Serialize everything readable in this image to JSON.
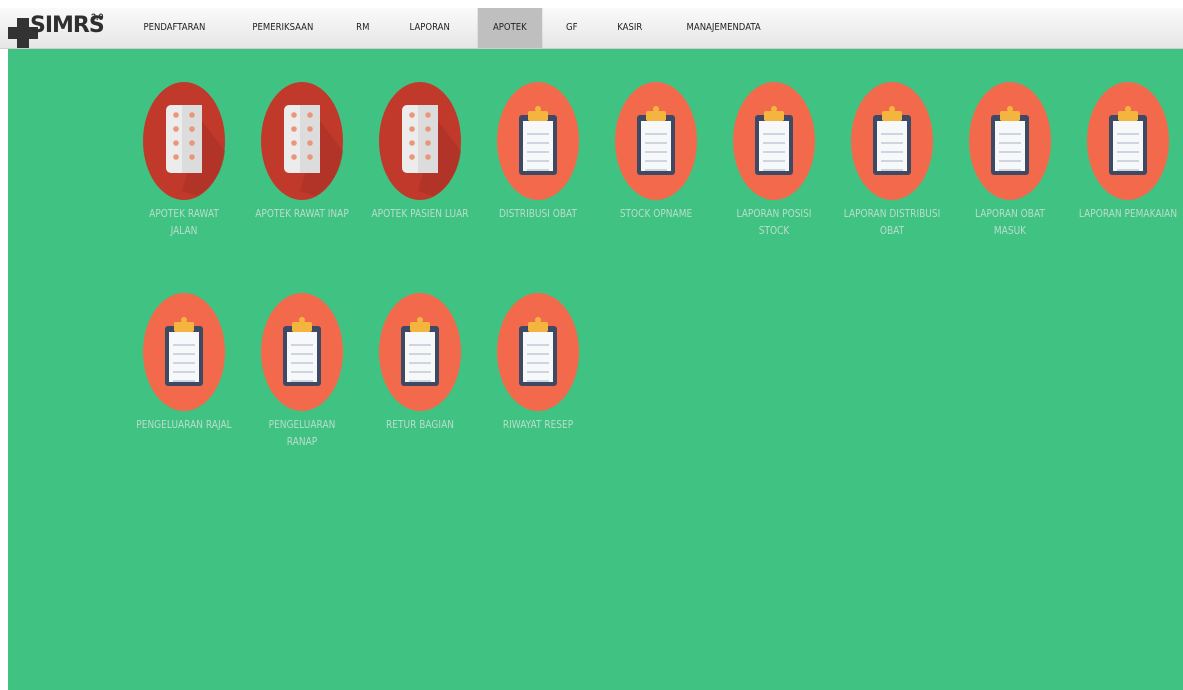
{
  "brand": {
    "name": "SIMRS",
    "version": "3.0"
  },
  "menu": [
    {
      "label": "PENDAFTARAN",
      "active": false
    },
    {
      "label": "PEMERIKSAAN",
      "active": false
    },
    {
      "label": "RM",
      "active": false
    },
    {
      "label": "LAPORAN",
      "active": false
    },
    {
      "label": "APOTEK",
      "active": true
    },
    {
      "label": "GF",
      "active": false
    },
    {
      "label": "KASIR",
      "active": false
    },
    {
      "label": "MANAJEMENDATA",
      "active": false
    }
  ],
  "tiles": [
    {
      "label": "APOTEK RAWAT JALAN",
      "icon": "pill-blister-icon"
    },
    {
      "label": "APOTEK RAWAT INAP",
      "icon": "pill-blister-icon"
    },
    {
      "label": "APOTEK PASIEN LUAR",
      "icon": "pill-blister-icon"
    },
    {
      "label": "DISTRIBUSI OBAT",
      "icon": "clipboard-icon"
    },
    {
      "label": "STOCK OPNAME",
      "icon": "clipboard-icon"
    },
    {
      "label": "LAPORAN POSISI STOCK",
      "icon": "clipboard-icon"
    },
    {
      "label": "LAPORAN DISTRIBUSI OBAT",
      "icon": "clipboard-icon"
    },
    {
      "label": "LAPORAN OBAT MASUK",
      "icon": "clipboard-icon"
    },
    {
      "label": "LAPORAN PEMAKAIAN",
      "icon": "clipboard-icon"
    },
    {
      "label": "PENGELUARAN RAJAL",
      "icon": "clipboard-icon"
    },
    {
      "label": "PENGELUARAN RANAP",
      "icon": "clipboard-icon"
    },
    {
      "label": "RETUR BAGIAN",
      "icon": "clipboard-icon"
    },
    {
      "label": "RIWAYAT RESEP",
      "icon": "clipboard-icon"
    }
  ],
  "colors": {
    "background": "#40c282",
    "pill_circle": "#c0392b",
    "clipboard_circle": "#f26a4b",
    "label_text": "#b9ddca",
    "active_menu": "#bfbfbf"
  }
}
